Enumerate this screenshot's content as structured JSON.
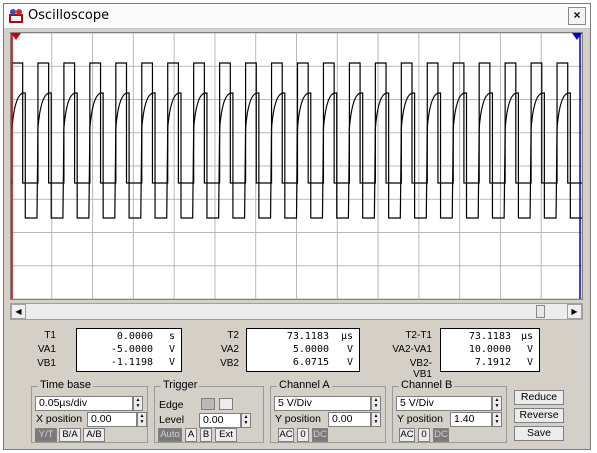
{
  "window": {
    "title": "Oscilloscope",
    "close": "×"
  },
  "readouts": {
    "t1": {
      "label_t": "T1",
      "t": "0.0000",
      "t_unit": "s",
      "label_va": "VA1",
      "va": "-5.0000",
      "va_unit": "V",
      "label_vb": "VB1",
      "vb": "-1.1198",
      "vb_unit": "V"
    },
    "t2": {
      "label_t": "T2",
      "t": "73.1183",
      "t_unit": "µs",
      "label_va": "VA2",
      "va": "5.0000",
      "va_unit": "V",
      "label_vb": "VB2",
      "vb": "6.0715",
      "vb_unit": "V"
    },
    "diff": {
      "label_t": "T2-T1",
      "t": "73.1183",
      "t_unit": "µs",
      "label_va": "VA2-VA1",
      "va": "10.0000",
      "va_unit": "V",
      "label_vb": "VB2-VB1",
      "vb": "7.1912",
      "vb_unit": "V"
    }
  },
  "timebase": {
    "title": "Time base",
    "value": "0.05µs/div",
    "xpos_label": "X position",
    "xpos": "0.00",
    "modes": [
      "Y/T",
      "B/A",
      "A/B"
    ],
    "active_mode": "Y/T"
  },
  "trigger": {
    "title": "Trigger",
    "edge_label": "Edge",
    "level_label": "Level",
    "level": "0.00",
    "sources": [
      "Auto",
      "A",
      "B",
      "Ext"
    ],
    "active_source": "Auto"
  },
  "channel_a": {
    "title": "Channel A",
    "scale": "5 V/Div",
    "ypos_label": "Y position",
    "ypos": "0.00",
    "coupling": [
      "AC",
      "0",
      "DC"
    ],
    "active_coupling": "DC"
  },
  "channel_b": {
    "title": "Channel B",
    "scale": "5 V/Div",
    "ypos_label": "Y position",
    "ypos": "1.40",
    "coupling": [
      "AC",
      "0",
      "DC"
    ],
    "active_coupling": "DC"
  },
  "actions": {
    "reduce": "Reduce",
    "reverse": "Reverse",
    "save": "Save"
  },
  "colors": {
    "grid": "#b8b8b8",
    "trace": "#000000",
    "cursor1": "#cc0000",
    "cursor2": "#0000cc"
  }
}
